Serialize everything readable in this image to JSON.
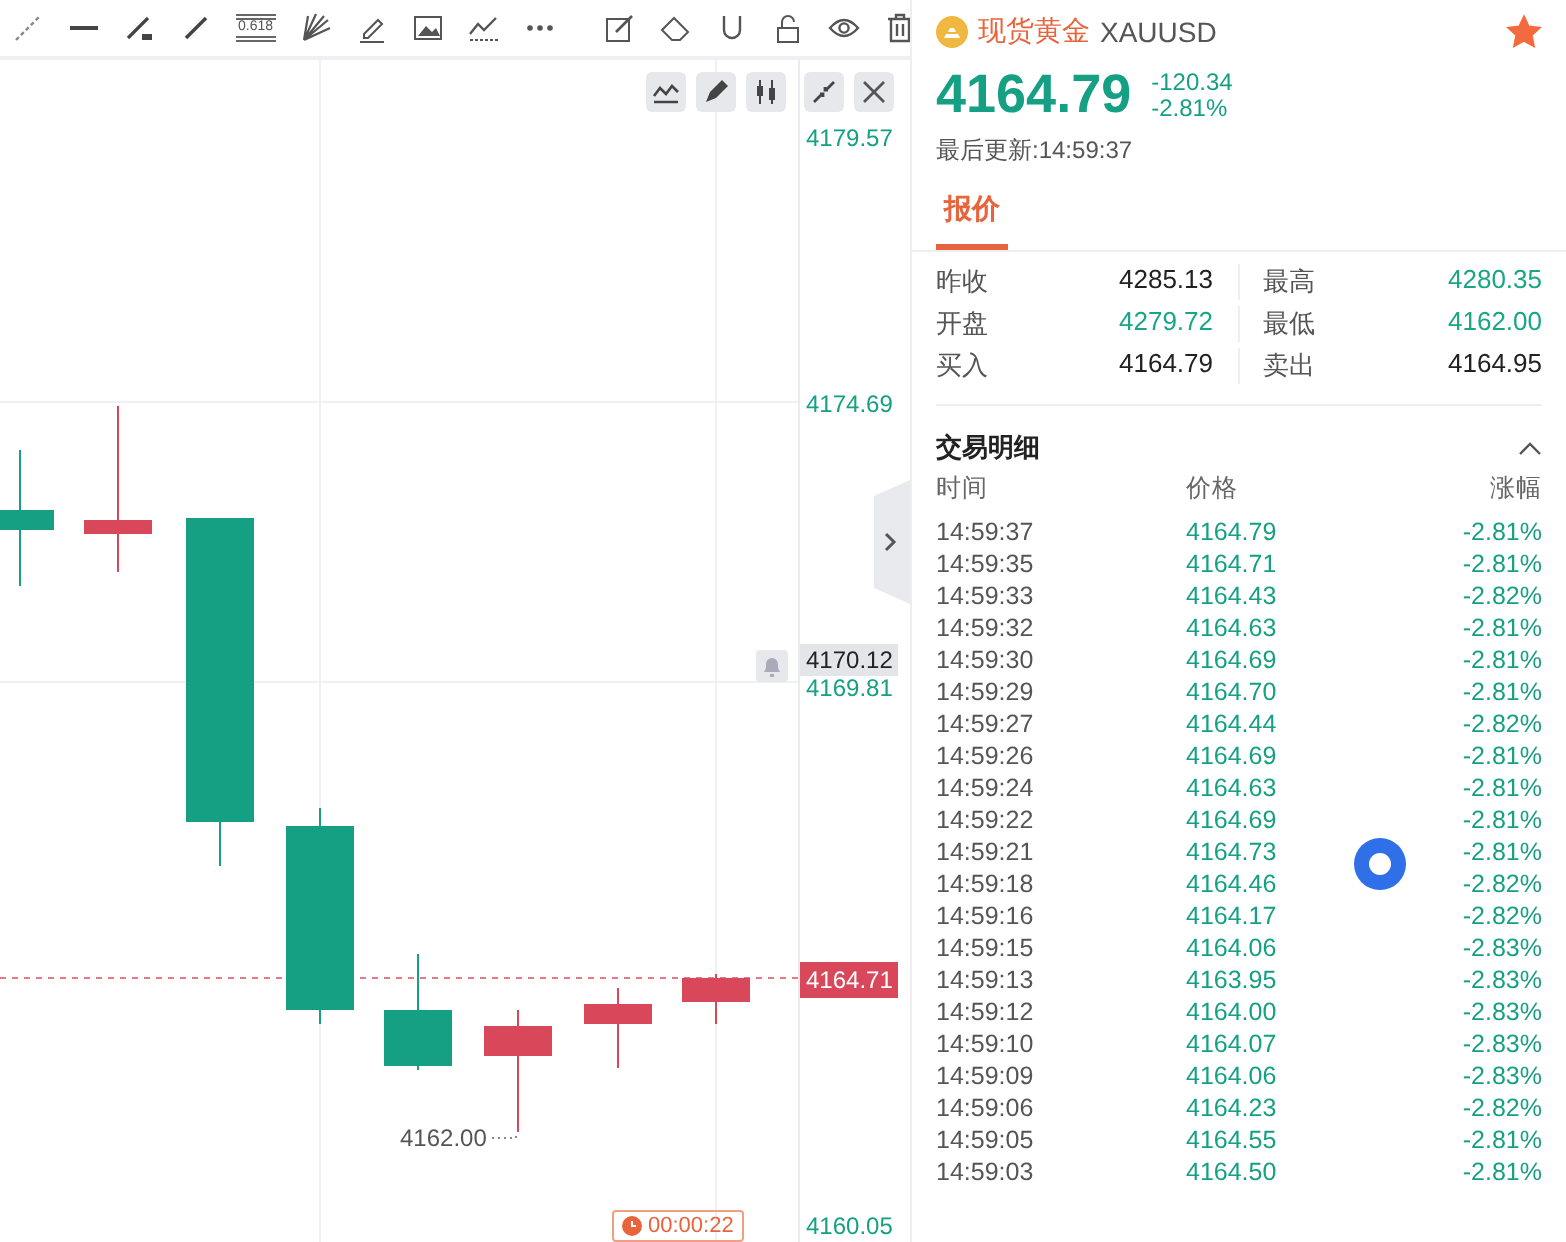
{
  "drawing_toolbar": {
    "fibonacci_label": "0.618"
  },
  "chart": {
    "price_axis": [
      "4179.57",
      "4174.69",
      "4169.81",
      "4160.05"
    ],
    "crosshair_price": "4170.12",
    "last_price": "4164.71",
    "low_label": "4162.00",
    "countdown": "00:00:22"
  },
  "quote": {
    "name": "现货黄金",
    "symbol": "XAUUSD",
    "favorite": true,
    "price": "4164.79",
    "change": "-120.34",
    "change_percent": "-2.81%",
    "updated": "最后更新:14:59:37",
    "tabs": [
      {
        "label": "报价",
        "selected": true
      }
    ],
    "fields": [
      {
        "label": "昨收",
        "value": "4285.13",
        "color": "#222222"
      },
      {
        "label": "最高",
        "value": "4280.35",
        "color": "#1aa587"
      },
      {
        "label": "开盘",
        "value": "4279.72",
        "color": "#1aa587"
      },
      {
        "label": "最低",
        "value": "4162.00",
        "color": "#1aa587"
      },
      {
        "label": "买入",
        "value": "4164.79",
        "color": "#222222"
      },
      {
        "label": "卖出",
        "value": "4164.95",
        "color": "#222222"
      }
    ]
  },
  "trades": {
    "title": "交易明细",
    "expanded": true,
    "columns": [
      "时间",
      "价格",
      "涨幅"
    ],
    "rows": [
      [
        "14:59:37",
        "4164.79",
        "-2.81%"
      ],
      [
        "14:59:35",
        "4164.71",
        "-2.81%"
      ],
      [
        "14:59:33",
        "4164.43",
        "-2.82%"
      ],
      [
        "14:59:32",
        "4164.63",
        "-2.81%"
      ],
      [
        "14:59:30",
        "4164.69",
        "-2.81%"
      ],
      [
        "14:59:29",
        "4164.70",
        "-2.81%"
      ],
      [
        "14:59:27",
        "4164.44",
        "-2.82%"
      ],
      [
        "14:59:26",
        "4164.69",
        "-2.81%"
      ],
      [
        "14:59:24",
        "4164.63",
        "-2.81%"
      ],
      [
        "14:59:22",
        "4164.69",
        "-2.81%"
      ],
      [
        "14:59:21",
        "4164.73",
        "-2.81%"
      ],
      [
        "14:59:18",
        "4164.46",
        "-2.82%"
      ],
      [
        "14:59:16",
        "4164.17",
        "-2.82%"
      ],
      [
        "14:59:15",
        "4164.06",
        "-2.83%"
      ],
      [
        "14:59:13",
        "4163.95",
        "-2.83%"
      ],
      [
        "14:59:12",
        "4164.00",
        "-2.83%"
      ],
      [
        "14:59:10",
        "4164.07",
        "-2.83%"
      ],
      [
        "14:59:09",
        "4164.06",
        "-2.83%"
      ],
      [
        "14:59:06",
        "4164.23",
        "-2.82%"
      ],
      [
        "14:59:05",
        "4164.55",
        "-2.81%"
      ],
      [
        "14:59:03",
        "4164.50",
        "-2.81%"
      ]
    ]
  }
}
